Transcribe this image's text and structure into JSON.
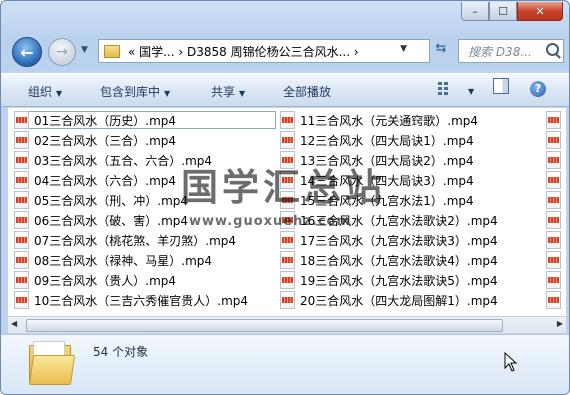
{
  "window": {
    "minimize": "–",
    "maximize": "☐",
    "close": "✕"
  },
  "address_bar": {
    "path": "«  国学...  ›  D3858 周锦伦杨公三合风水...  ›",
    "search_placeholder": "搜索 D38..."
  },
  "toolbar": {
    "organize": "组织",
    "include_in_library": "包含到库中",
    "share": "共享",
    "play_all": "全部播放"
  },
  "files_col1": [
    "01三合风水（历史）.mp4",
    "02三合风水（三合）.mp4",
    "03三合风水（五合、六合）.mp4",
    "04三合风水（六合）.mp4",
    "05三合风水（刑、冲）.mp4",
    "06三合风水（破、害）.mp4",
    "07三合风水（桃花煞、羊刃煞）.mp4",
    "08三合风水（禄神、马星）.mp4",
    "09三合风水（贵人）.mp4",
    "10三合风水（三吉六秀催官贵人）.mp4"
  ],
  "files_col2": [
    "11三合风水（元关通窍歌）.mp4",
    "12三合风水（四大局诀1）.mp4",
    "13三合风水（四大局诀2）.mp4",
    "14三合风水（四大局诀3）.mp4",
    "15三合风水（九宫水法1）.mp4",
    "16三合风水（九宫水法歌诀2）.mp4",
    "17三合风水（九宫水法歌诀3）.mp4",
    "18三合风水（九宫水法歌诀4）.mp4",
    "19三合风水（九宫水法歌诀5）.mp4",
    "20三合风水（四大龙局图解1）.mp4"
  ],
  "status": {
    "count": "54 个对象"
  },
  "watermark": {
    "title": "国学汇总站",
    "url": "www.guoxuehz.com"
  }
}
